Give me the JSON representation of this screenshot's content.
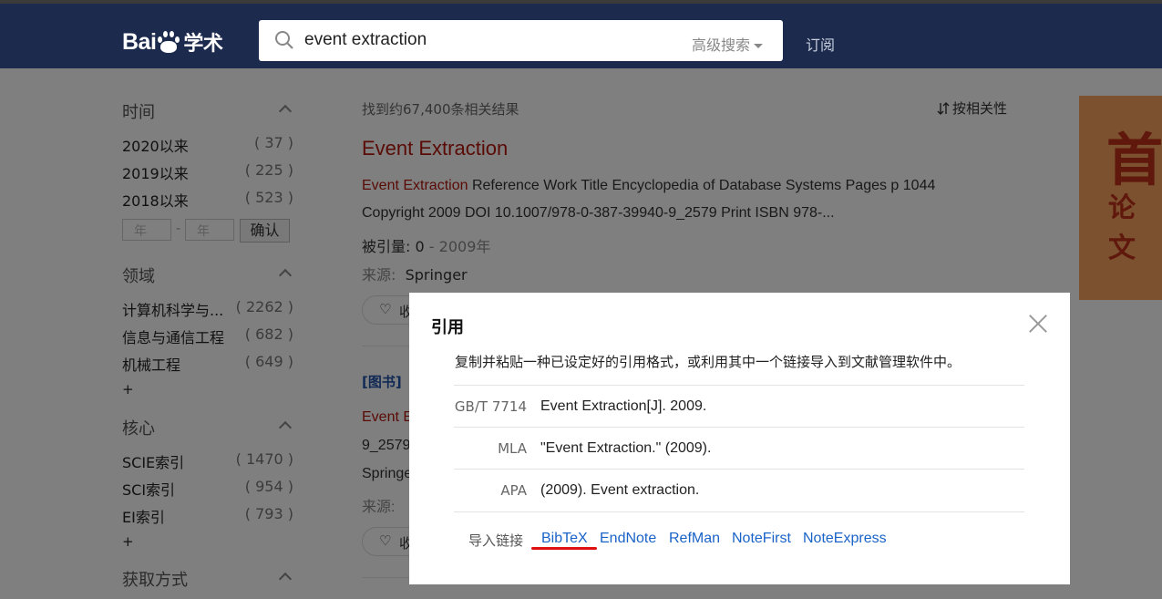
{
  "header": {
    "logo_text": "Bai",
    "logo_text_2": "学术",
    "search_query": "event extraction",
    "advanced_search": "高级搜索",
    "subscribe": "订阅"
  },
  "sidebar": {
    "time_heading": "时间",
    "time_items": [
      {
        "label": "2020以来",
        "count": "( 37 )"
      },
      {
        "label": "2019以来",
        "count": "( 225 )"
      },
      {
        "label": "2018以来",
        "count": "( 523 )"
      }
    ],
    "year_placeholder": "年",
    "year_dash": "-",
    "confirm": "确认",
    "field_heading": "领域",
    "field_items": [
      {
        "label": "计算机科学与...",
        "count": "( 2262 )"
      },
      {
        "label": "信息与通信工程",
        "count": "( 682 )"
      },
      {
        "label": "机械工程",
        "count": "( 649 )"
      }
    ],
    "more": "+",
    "core_heading": "核心",
    "core_items": [
      {
        "label": "SCIE索引",
        "count": "( 1470 )"
      },
      {
        "label": "SCI索引",
        "count": "( 954 )"
      },
      {
        "label": "EI索引",
        "count": "( 793 )"
      }
    ],
    "access_heading": "获取方式"
  },
  "results": {
    "count_text": "找到约67,400条相关结果",
    "sort_label": "按相关性",
    "items": [
      {
        "title": "Event Extraction",
        "snippet_highlight": "Event Extraction",
        "snippet_rest": " Reference Work Title Encyclopedia of Database Systems Pages p 1044",
        "snippet_line2": "Copyright 2009 DOI 10.1007/978-0-387-39940-9_2579 Print ISBN 978-...",
        "cited_label": "被引量:",
        "cited_value": "0",
        "dash": "-",
        "year": "2009年",
        "source_label": "来源:",
        "source_value": "Springer",
        "fav_label": "收"
      }
    ],
    "second": {
      "tag": "[图书]",
      "title_partial": "Event E",
      "line_partial": "9_2579",
      "source_partial": "Springe",
      "source_label": "来源:",
      "fav_label": "收"
    }
  },
  "ad": {
    "big_char": "首",
    "small_text": "论文"
  },
  "modal": {
    "title": "引用",
    "description": "复制并粘贴一种已设定好的引用格式，或利用其中一个链接导入到文献管理软件中。",
    "citations": [
      {
        "style": "GB/T 7714",
        "text": "Event Extraction[J]. 2009."
      },
      {
        "style": "MLA",
        "text": "\"Event Extraction.\" (2009)."
      },
      {
        "style": "APA",
        "text": "(2009). Event extraction."
      }
    ],
    "import_label": "导入链接",
    "import_links": [
      "BibTeX",
      "EndNote",
      "RefMan",
      "NoteFirst",
      "NoteExpress"
    ]
  },
  "colors": {
    "header_bg": "#1c2a4d",
    "highlight_red": "#b5160d",
    "link_blue": "#1a63c7",
    "annotation_red": "#e01010"
  }
}
